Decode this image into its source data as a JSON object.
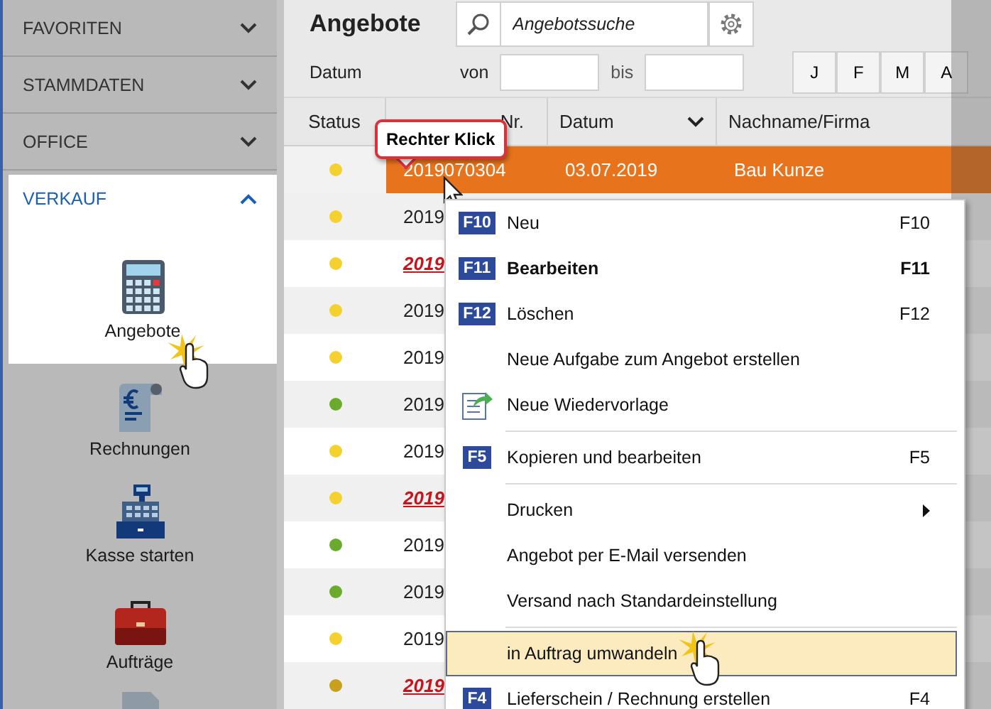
{
  "sidebar": {
    "sections": [
      {
        "label": "FAVORITEN",
        "expanded": false
      },
      {
        "label": "STAMMDATEN",
        "expanded": false
      },
      {
        "label": "OFFICE",
        "expanded": false
      },
      {
        "label": "VERKAUF",
        "expanded": true,
        "items": [
          {
            "label": "Angebote",
            "kind": "calculator",
            "selected": true
          },
          {
            "label": "Rechnungen",
            "kind": "invoice",
            "selected": false
          },
          {
            "label": "Kasse starten",
            "kind": "register",
            "selected": false
          },
          {
            "label": "Aufträge",
            "kind": "briefcase",
            "selected": false
          }
        ]
      }
    ]
  },
  "header": {
    "title": "Angebote",
    "search": {
      "placeholder": "Angebotssuche"
    },
    "date_filter": {
      "label": "Datum",
      "from_label": "von",
      "to_label": "bis"
    },
    "months": [
      "J",
      "F",
      "M",
      "A"
    ]
  },
  "table": {
    "columns": [
      {
        "label": "Status",
        "sorted": false
      },
      {
        "label": "Nr.",
        "sorted": false
      },
      {
        "label": "Datum",
        "sorted": true
      },
      {
        "label": "Nachname/Firma",
        "sorted": false
      }
    ],
    "rows": [
      {
        "color": "#f5d130",
        "number": "2019070304",
        "date": "03.07.2019",
        "name": "Bau Kunze",
        "selected": true,
        "overdue": false
      },
      {
        "color": "#f5d130",
        "number": "2019",
        "selected": false,
        "overdue": false
      },
      {
        "color": "#f5d130",
        "number": "2019",
        "selected": false,
        "overdue": true
      },
      {
        "color": "#f5d130",
        "number": "2019",
        "selected": false,
        "overdue": false
      },
      {
        "color": "#f5d130",
        "number": "2019",
        "selected": false,
        "overdue": false
      },
      {
        "color": "#6aab2e",
        "number": "2019",
        "selected": false,
        "overdue": false
      },
      {
        "color": "#f5d130",
        "number": "2019",
        "selected": false,
        "overdue": false
      },
      {
        "color": "#f5d130",
        "number": "2019",
        "selected": false,
        "overdue": true
      },
      {
        "color": "#6aab2e",
        "number": "2019",
        "selected": false,
        "overdue": false
      },
      {
        "color": "#6aab2e",
        "number": "2019",
        "selected": false,
        "overdue": false
      },
      {
        "color": "#f5d130",
        "number": "2019",
        "selected": false,
        "overdue": false
      },
      {
        "color": "#c9a01c",
        "number": "2019",
        "selected": false,
        "overdue": true
      }
    ]
  },
  "tooltip": {
    "text": "Rechter Klick"
  },
  "context_menu": {
    "items": [
      {
        "kind": "item",
        "badge": "F10",
        "label": "Neu",
        "shortcut": "F10",
        "default": false,
        "highlighted": false
      },
      {
        "kind": "item",
        "badge": "F11",
        "label": "Bearbeiten",
        "shortcut": "F11",
        "default": true,
        "highlighted": false
      },
      {
        "kind": "item",
        "badge": "F12",
        "label": "Löschen",
        "shortcut": "F12",
        "default": false,
        "highlighted": false
      },
      {
        "kind": "item",
        "label": "Neue Aufgabe zum Angebot erstellen",
        "default": false,
        "highlighted": false
      },
      {
        "kind": "icon_item",
        "label": "Neue Wiedervorlage",
        "default": false,
        "highlighted": false
      },
      {
        "kind": "separator"
      },
      {
        "kind": "item",
        "badge": "F5",
        "label": "Kopieren und bearbeiten",
        "shortcut": "F5",
        "default": false,
        "highlighted": false
      },
      {
        "kind": "separator"
      },
      {
        "kind": "submenu",
        "label": "Drucken",
        "default": false,
        "highlighted": false
      },
      {
        "kind": "item",
        "label": "Angebot per E-Mail versenden",
        "default": false,
        "highlighted": false
      },
      {
        "kind": "item",
        "label": "Versand nach Standardeinstellung",
        "default": false,
        "highlighted": false
      },
      {
        "kind": "separator"
      },
      {
        "kind": "item",
        "label": "in Auftrag umwandeln",
        "default": false,
        "highlighted": true
      },
      {
        "kind": "item",
        "badge": "F4",
        "label": "Lieferschein / Rechnung erstellen",
        "shortcut": "F4",
        "default": false,
        "highlighted": false
      }
    ]
  }
}
